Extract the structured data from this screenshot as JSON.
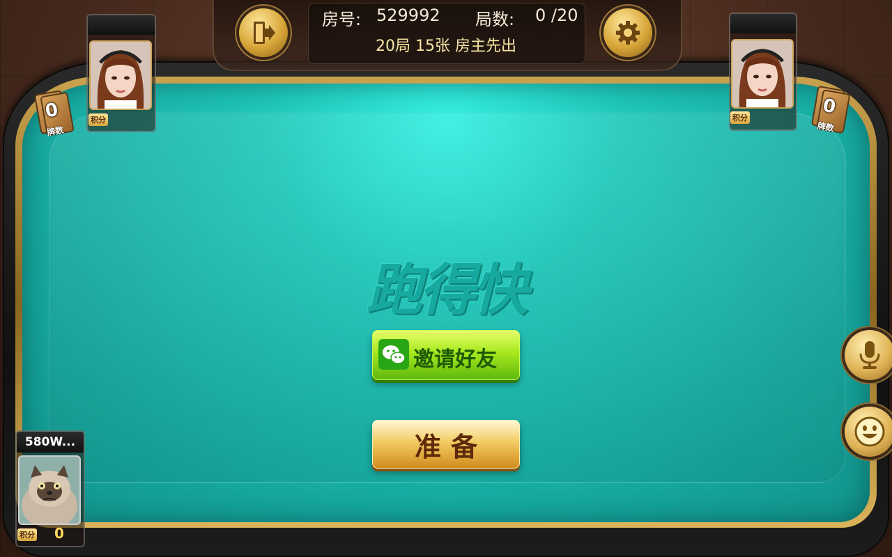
{
  "header": {
    "room_label": "房号:",
    "room_number": "529992",
    "rounds_label": "局数:",
    "rounds_value": "0 /20",
    "rules": "20局 15张 房主先出"
  },
  "buttons": {
    "exit_icon": "exit-door-icon",
    "settings_icon": "gear-icon",
    "invite_label": "邀请好友",
    "ready_label": "准备",
    "mic_icon": "microphone-icon",
    "emoji_icon": "smiley-icon"
  },
  "watermark": "跑得快",
  "players": {
    "left": {
      "score_label": "积分",
      "card_count": "0",
      "card_count_label": "牌数"
    },
    "right": {
      "score_label": "积分",
      "card_count": "0",
      "card_count_label": "牌数"
    },
    "self": {
      "name": "580W...",
      "score_label": "积分",
      "score": "0"
    }
  },
  "colors": {
    "felt": "#20c8bb",
    "gold": "#d6a63c",
    "invite_green": "#a7e81e"
  }
}
